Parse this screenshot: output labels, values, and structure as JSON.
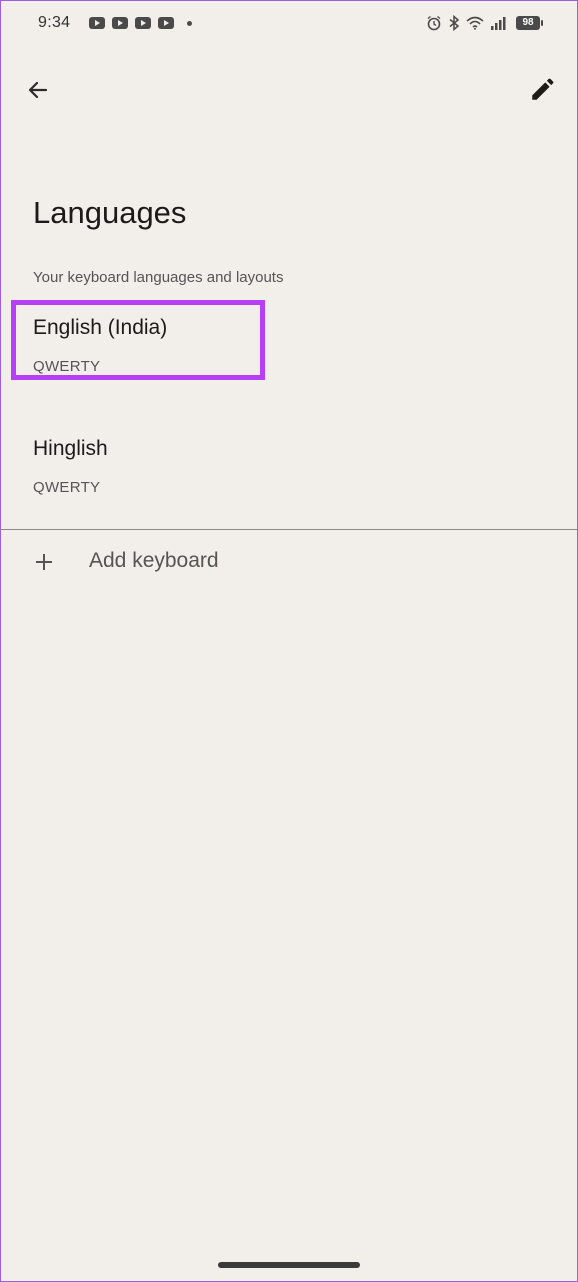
{
  "status_bar": {
    "time": "9:34",
    "battery": "98",
    "notification_icons": [
      "youtube-icon",
      "youtube-icon",
      "youtube-icon",
      "youtube-icon"
    ],
    "system_icons": [
      "alarm-icon",
      "bluetooth-icon",
      "wifi-icon",
      "signal-icon",
      "battery-icon"
    ]
  },
  "app_bar": {
    "back_icon": "arrow-back-icon",
    "edit_icon": "pencil-icon"
  },
  "page": {
    "title": "Languages",
    "section_label": "Your keyboard languages and layouts"
  },
  "languages": [
    {
      "name": "English (India)",
      "layout": "QWERTY"
    },
    {
      "name": "Hinglish",
      "layout": "QWERTY"
    }
  ],
  "add_keyboard": {
    "icon": "plus-icon",
    "label": "Add keyboard"
  },
  "colors": {
    "background": "#f2eeea",
    "highlight": "#b540f5"
  }
}
